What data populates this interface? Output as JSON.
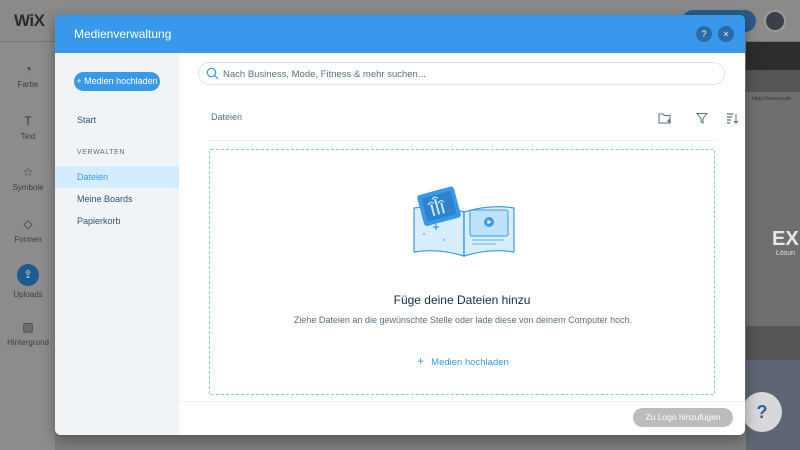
{
  "editor": {
    "logo": "WiX",
    "tools": [
      {
        "label": "Farbe",
        "icon": "palette-icon"
      },
      {
        "label": "Text",
        "icon": "text-icon"
      },
      {
        "label": "Symbole",
        "icon": "star-icon"
      },
      {
        "label": "Formen",
        "icon": "shapes-icon"
      },
      {
        "label": "Uploads",
        "icon": "upload-icon"
      },
      {
        "label": "Hintergrund",
        "icon": "background-icon"
      }
    ],
    "canvas_url": "https://www.mydo",
    "canvas_headline": "EX",
    "canvas_sub": "Lösun",
    "help_label": "?"
  },
  "modal": {
    "title": "Medienverwaltung",
    "help_label": "?",
    "close_label": "×",
    "upload_button": "+ Medien hochladen",
    "nav": {
      "start": "Start",
      "section": "VERWALTEN",
      "items": [
        "Dateien",
        "Meine Boards",
        "Papierkorb"
      ]
    },
    "search_placeholder": "Nach Business, Mode, Fitness & mehr suchen...",
    "breadcrumb": "Dateien",
    "dropzone": {
      "title": "Füge deine Dateien hinzu",
      "subtitle": "Ziehe Dateien an die gewünschte Stelle oder lade diese von deinem Computer hoch.",
      "link_plus": "+",
      "link_label": "Medien hochladen"
    },
    "add_logo_button": "Zu Logo hinzufügen"
  },
  "colors": {
    "accent": "#3899ec",
    "active_nav_bg": "#d3edff",
    "disabled_button": "#bcbcbc"
  }
}
